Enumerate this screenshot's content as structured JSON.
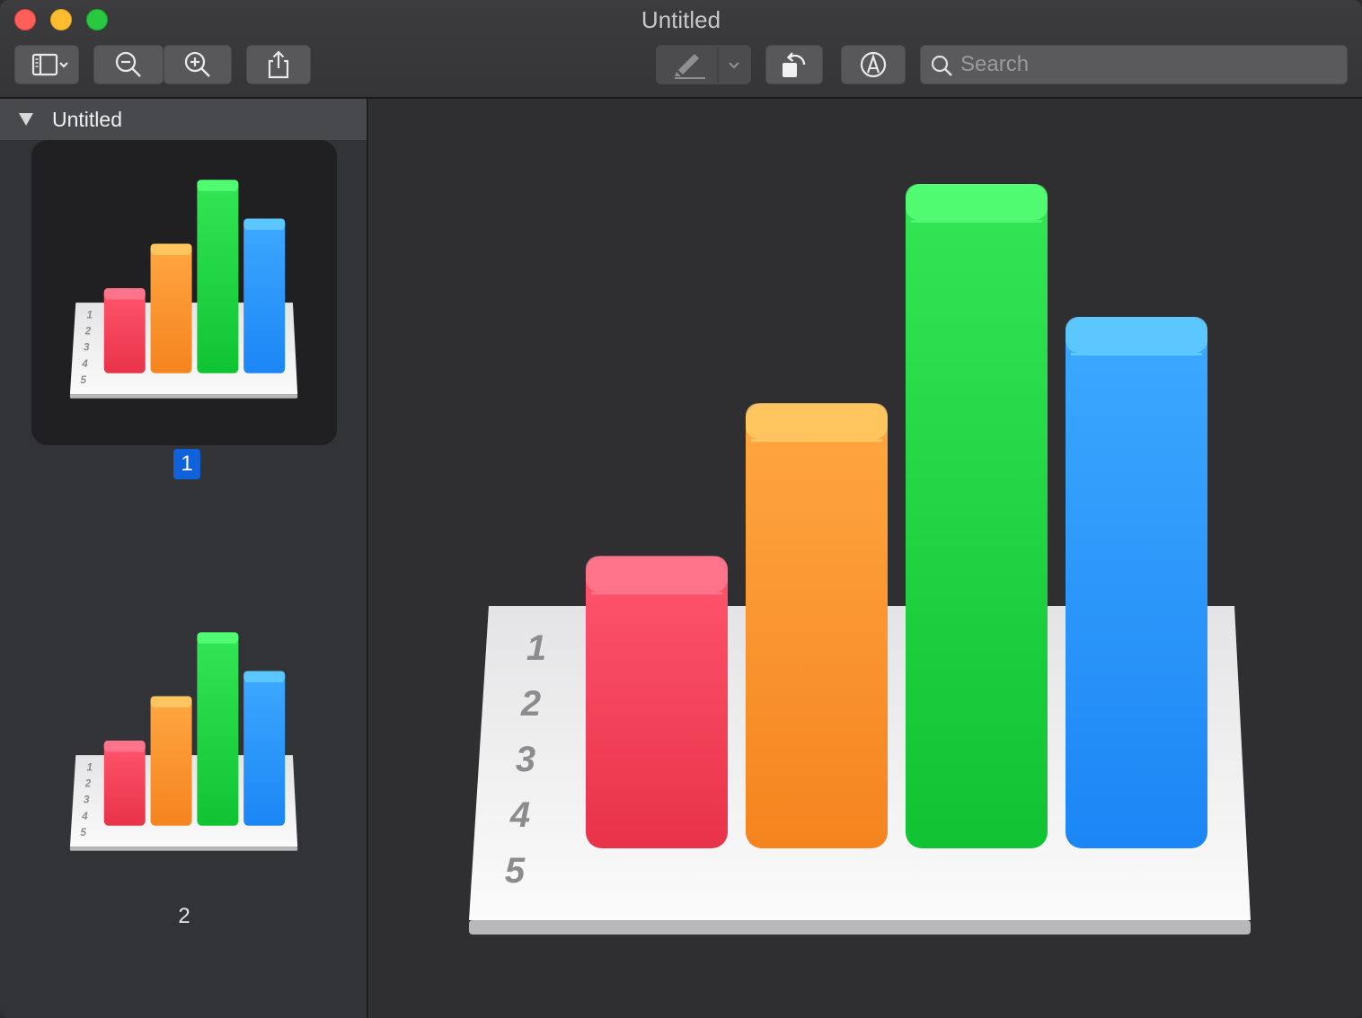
{
  "window": {
    "title": "Untitled"
  },
  "toolbar": {
    "sidebar_toggle": "sidebar-toggle-icon",
    "zoom_out": "zoom-out-icon",
    "zoom_in": "zoom-in-icon",
    "share": "share-icon",
    "highlight": "highlighter-icon",
    "rotate": "rotate-left-icon",
    "markup": "markup-icon",
    "search_placeholder": "Search"
  },
  "sidebar": {
    "document_name": "Untitled",
    "pages": [
      {
        "label": "1",
        "selected": true
      },
      {
        "label": "2",
        "selected": false
      }
    ]
  },
  "image_content": {
    "description_icon": "numbers-app-icon",
    "row_numbers": [
      "1",
      "2",
      "3",
      "4",
      "5"
    ],
    "bars": [
      {
        "color": "#e8334a",
        "level": 0.44
      },
      {
        "color": "#f5841f",
        "level": 0.67
      },
      {
        "color": "#10c332",
        "level": 1.0
      },
      {
        "color": "#1b86f5",
        "level": 0.8
      }
    ]
  }
}
